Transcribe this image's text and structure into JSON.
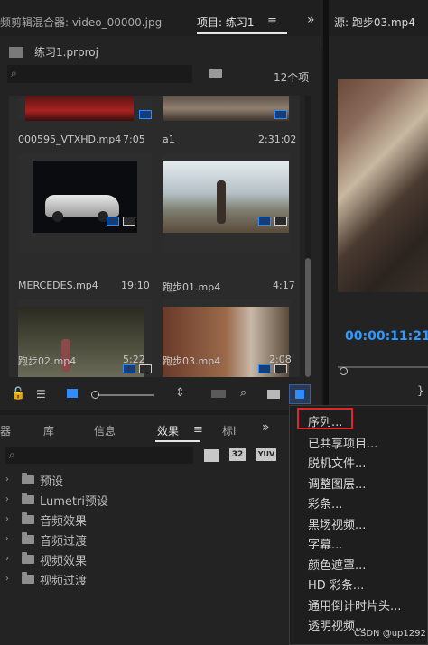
{
  "header": {
    "audio_mixer_tab": "频剪辑混合器: video_00000.jpg",
    "project_tab": "项目: 练习1",
    "source_tab": "源: 跑步03.mp4",
    "menu_icon": "hamburger-icon",
    "expand_icon": "double-chevron-icon"
  },
  "project": {
    "file_name": "练习1.prproj",
    "search_placeholder": "",
    "item_count": "12个项",
    "items": [
      {
        "name": "000595_VTXHD.mp4",
        "duration": "7:05"
      },
      {
        "name": "a1",
        "duration": "2:31:02"
      },
      {
        "name": "MERCEDES.mp4",
        "duration": "19:10"
      },
      {
        "name": "跑步01.mp4",
        "duration": "4:17"
      },
      {
        "name": "跑步02.mp4",
        "duration": "5:22"
      },
      {
        "name": "跑步03.mp4",
        "duration": "2:08"
      }
    ]
  },
  "source": {
    "timecode": "00:00:11:21"
  },
  "bottom_tabs": {
    "t0": "器",
    "t1": "库",
    "t2": "信息",
    "t3": "效果",
    "t4": "标i"
  },
  "effects": {
    "search_placeholder": "",
    "badge_32": "32",
    "badge_yuv": "YUV",
    "tree": [
      "预设",
      "Lumetri预设",
      "音频效果",
      "音频过渡",
      "视频效果",
      "视频过渡"
    ]
  },
  "new_item_menu": {
    "items": [
      "序列...",
      "已共享项目...",
      "脱机文件...",
      "调整图层...",
      "彩条...",
      "黑场视频...",
      "字幕...",
      "颜色遮罩...",
      "HD 彩条...",
      "通用倒计时片头...",
      "透明视频..."
    ],
    "highlighted": "序列..."
  },
  "watermark": "CSDN @up1292",
  "colors": {
    "accent": "#2f8cff",
    "highlight_box": "#e0252b",
    "timecode": "#2f9bff"
  }
}
